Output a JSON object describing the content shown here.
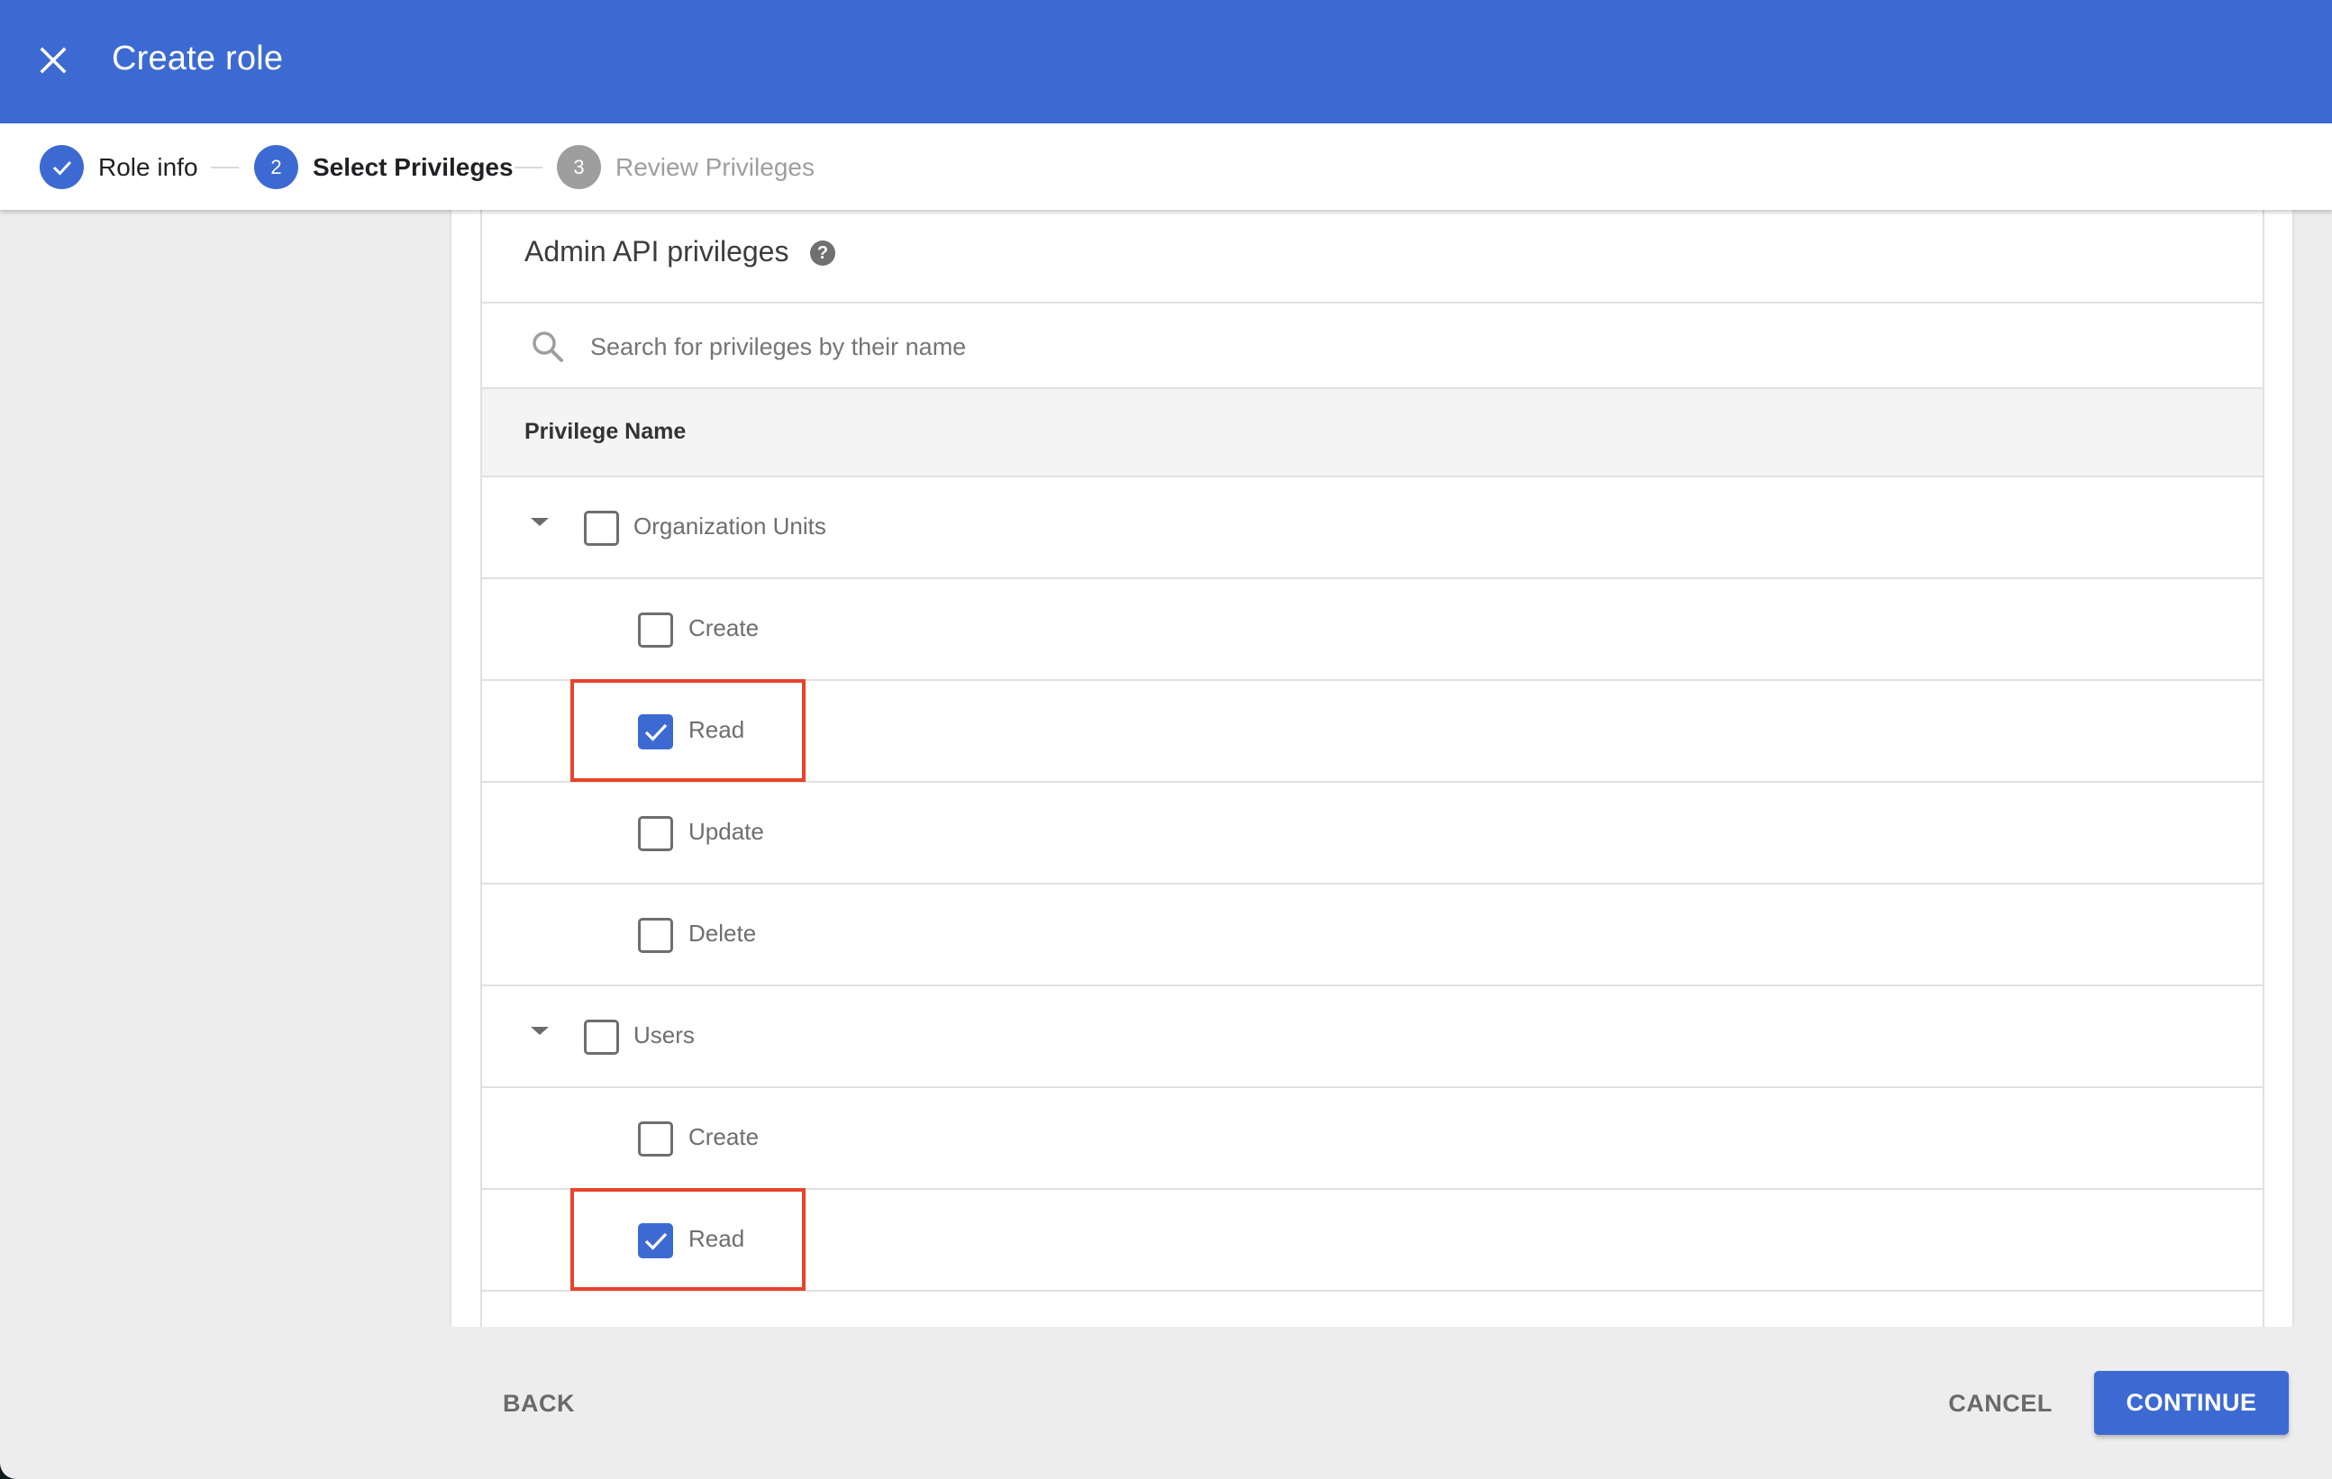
{
  "appbar": {
    "title": "Create role",
    "close_icon": "close-icon",
    "color": "#3d6ad2"
  },
  "stepper": {
    "steps": [
      {
        "number": "1",
        "label": "Role info",
        "state": "completed",
        "icon": "check-icon"
      },
      {
        "number": "2",
        "label": "Select Privileges",
        "state": "active"
      },
      {
        "number": "3",
        "label": "Review Privileges",
        "state": "upcoming"
      }
    ]
  },
  "card": {
    "title": "Admin API privileges",
    "help_icon": "help-icon",
    "help_glyph": "?",
    "search": {
      "placeholder": "Search for privileges by their name",
      "value": ""
    },
    "table_header": "Privilege Name",
    "rows": [
      {
        "level": "parent",
        "label": "Organization Units",
        "checked": false,
        "expanded": true,
        "highlighted": false
      },
      {
        "level": "child",
        "label": "Create",
        "checked": false,
        "highlighted": false
      },
      {
        "level": "child",
        "label": "Read",
        "checked": true,
        "highlighted": true
      },
      {
        "level": "child",
        "label": "Update",
        "checked": false,
        "highlighted": false
      },
      {
        "level": "child",
        "label": "Delete",
        "checked": false,
        "highlighted": false
      },
      {
        "level": "parent",
        "label": "Users",
        "checked": false,
        "expanded": true,
        "highlighted": false
      },
      {
        "level": "child",
        "label": "Create",
        "checked": false,
        "highlighted": false
      },
      {
        "level": "child",
        "label": "Read",
        "checked": true,
        "highlighted": true
      }
    ]
  },
  "footer": {
    "back_label": "BACK",
    "cancel_label": "CANCEL",
    "continue_label": "CONTINUE"
  },
  "colors": {
    "primary": "#3d6ad2",
    "step_upcoming": "#9e9e9e",
    "highlight_border": "#e8432b"
  }
}
